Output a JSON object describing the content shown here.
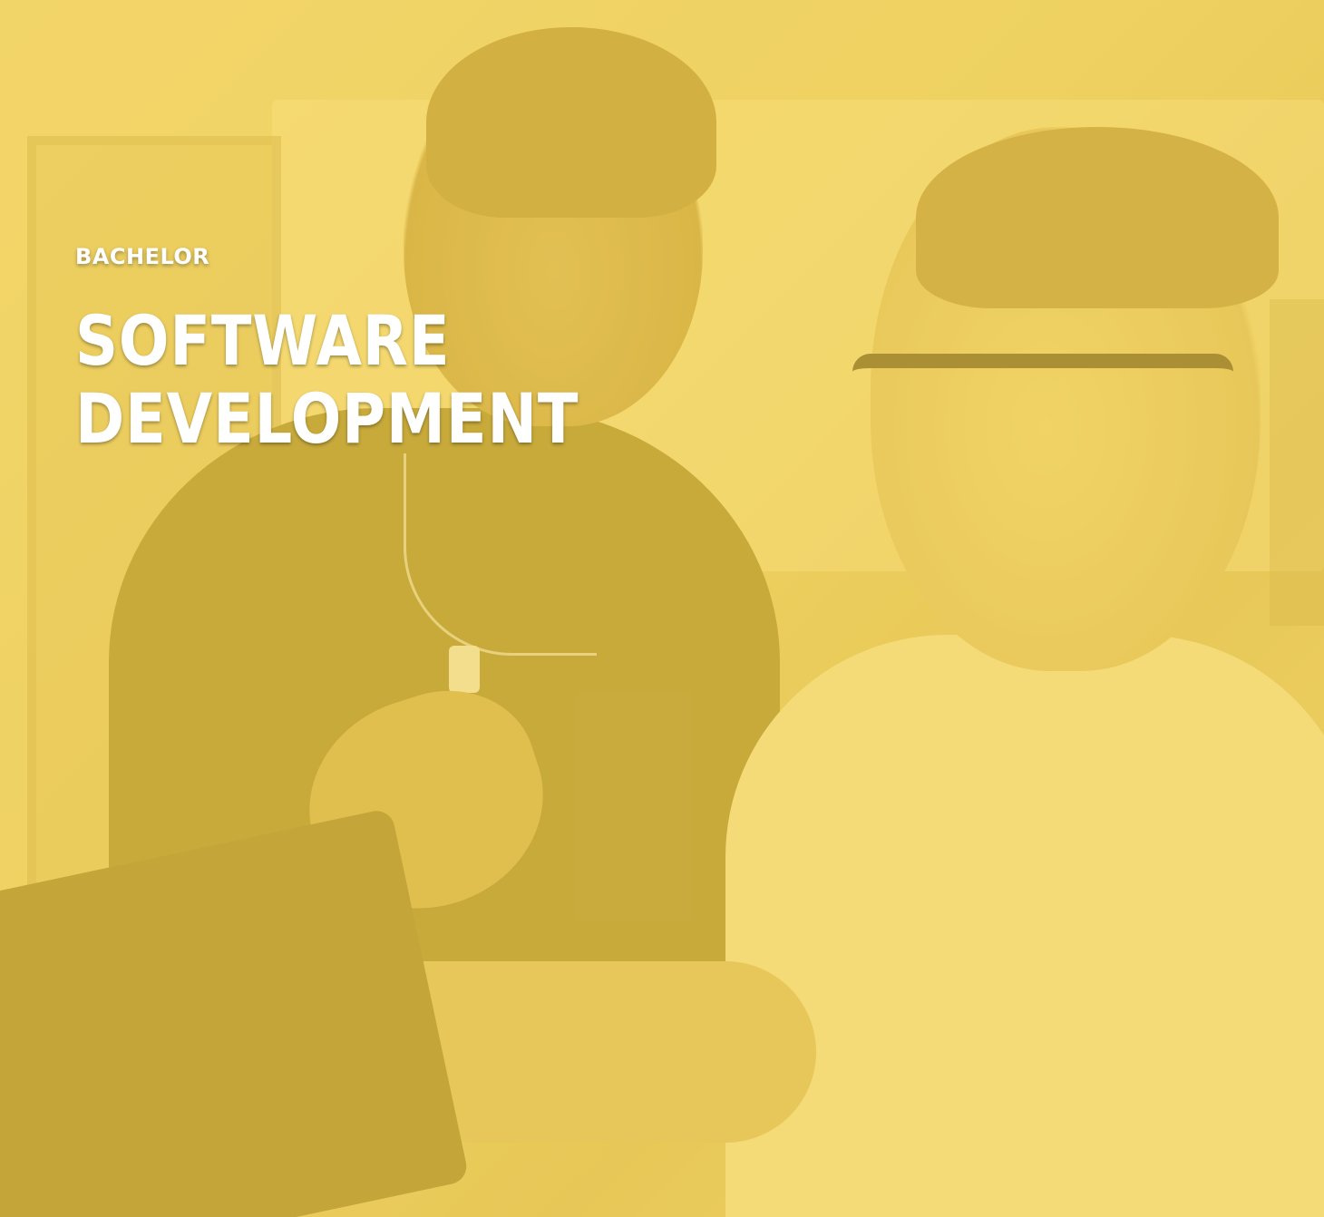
{
  "hero": {
    "eyebrow": "BACHELOR",
    "title_line_1": "SOFTWARE",
    "title_line_2": "DEVELOPMENT"
  },
  "image": {
    "overlay_color": "#F0D060",
    "text_color": "#FFFFFF"
  }
}
